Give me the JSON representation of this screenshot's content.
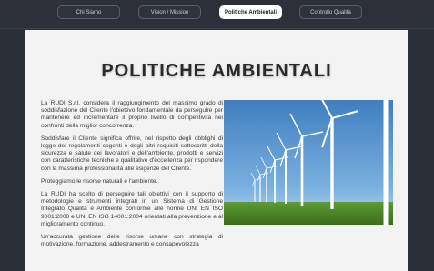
{
  "nav": {
    "tabs": [
      {
        "label": "Chi Siamo"
      },
      {
        "label": "Vision / Mission"
      },
      {
        "label": "Politiche Ambientali"
      },
      {
        "label": "Controllo Qualità"
      }
    ]
  },
  "page": {
    "title": "POLITICHE AMBIENTALI",
    "paragraphs": [
      "La RUDI S.r.l. considera il raggiungimento del massimo grado di soddisfazione del Cliente l'obiettivo fondamentale da perseguire per mantenere ed incrementare il proprio livello di competitività nei confronti della miglior concorrenza.",
      "Soddisfare il Cliente significa offrire, nel rispetto degli obblighi di legge dei regolamenti cogenti e degli altri requisiti sottoscritti della sicurezza e salute dei lavoratori e dell'ambiente, prodotti e servizi con caratteristiche tecniche e qualitative d'eccellenza per rispondere con la massima professionalità alle esigenze del Cliente.",
      "Proteggiamo le risorse naturali e l'ambiente.",
      "La RUDI ha scelto di perseguire tali obiettivi con il supporto di metodologie e strumenti integrati in un Sistema di Gestione Integrato Qualità e Ambiente conforme alle norme UNI EN ISO 9001:2008 e UNI EN ISO 14001:2004 orientati alla prevenzione e al miglioramento continuo.",
      "Un'accurata gestione delle risorse umane con strategia di motivazione, formazione, addestramento e consapevolezza"
    ]
  },
  "colors": {
    "header_bg": "#2d3038",
    "content_bg": "#f3f3f3",
    "active_tab_bg": "#ffffff",
    "sky": "#4a86c4",
    "grass": "#4f8a2a"
  }
}
